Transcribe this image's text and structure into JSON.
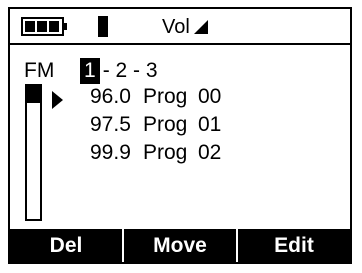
{
  "status_bar": {
    "battery_icon": "battery-icon",
    "signal_icon": "signal-bar-icon",
    "volume_label": "Vol",
    "volume_icon": "volume-triangle-icon"
  },
  "mode": "FM",
  "banks": {
    "selected": "1",
    "rest": "- 2 - 3"
  },
  "pointer_icon": "arrow-right-icon",
  "programs": [
    {
      "freq": "96.0",
      "name": "Prog",
      "num": "00"
    },
    {
      "freq": "97.5",
      "name": "Prog",
      "num": "01"
    },
    {
      "freq": "99.9",
      "name": "Prog",
      "num": "02"
    }
  ],
  "softkeys": {
    "left": "Del",
    "middle": "Move",
    "right": "Edit"
  },
  "colors": {
    "foreground": "#000000",
    "background": "#ffffff"
  }
}
